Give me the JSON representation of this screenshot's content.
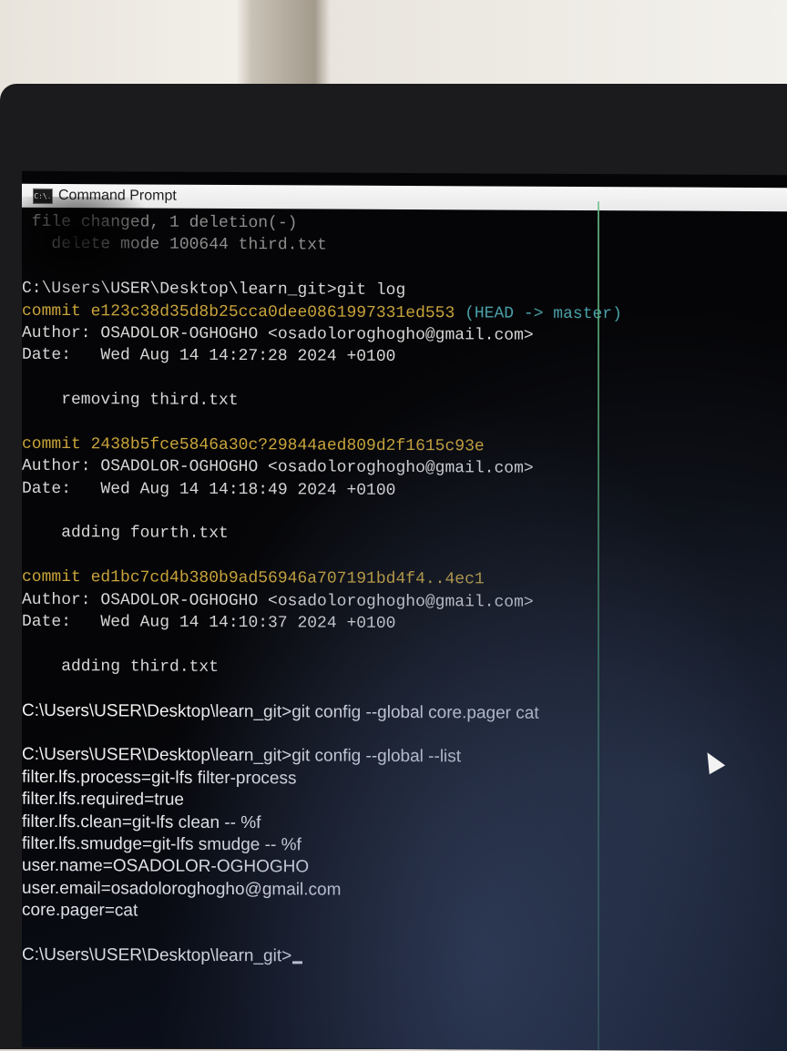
{
  "window": {
    "title": "Command Prompt",
    "icon": "cmd-icon",
    "icon_text": "C:\\."
  },
  "console": {
    "lines": [
      {
        "text": " file changed, 1 deletion(-)",
        "kind": "dim"
      },
      {
        "text": "   delete mode 100644 third.txt",
        "kind": "dim"
      },
      {
        "text": "",
        "kind": "normal"
      },
      {
        "text": "C:\\Users\\USER\\Desktop\\learn_git>git log",
        "kind": "normal"
      },
      {
        "text": "commit e123c38d35d8b25cca0dee0861997331ed553",
        "kind": "commit",
        "ref": " (HEAD -> master)"
      },
      {
        "text": "Author: OSADOLOR-OGHOGHO <osadoloroghogho@gmail.com>",
        "kind": "normal"
      },
      {
        "text": "Date:   Wed Aug 14 14:27:28 2024 +0100",
        "kind": "normal"
      },
      {
        "text": "",
        "kind": "normal"
      },
      {
        "text": "    removing third.txt",
        "kind": "normal"
      },
      {
        "text": "",
        "kind": "normal"
      },
      {
        "text": "commit 2438b5fce5846a30c?29844aed809d2f1615c93e",
        "kind": "commit"
      },
      {
        "text": "Author: OSADOLOR-OGHOGHO <osadoloroghogho@gmail.com>",
        "kind": "normal"
      },
      {
        "text": "Date:   Wed Aug 14 14:18:49 2024 +0100",
        "kind": "normal"
      },
      {
        "text": "",
        "kind": "normal"
      },
      {
        "text": "    adding fourth.txt",
        "kind": "normal"
      },
      {
        "text": "",
        "kind": "normal"
      },
      {
        "text": "commit ed1bc7cd4b380b9ad56946a707191bd4f4..4ec1",
        "kind": "commit"
      },
      {
        "text": "Author: OSADOLOR-OGHOGHO <osadoloroghogho@gmail.com>",
        "kind": "normal"
      },
      {
        "text": "Date:   Wed Aug 14 14:10:37 2024 +0100",
        "kind": "normal"
      },
      {
        "text": "",
        "kind": "normal"
      },
      {
        "text": "    adding third.txt",
        "kind": "normal"
      },
      {
        "text": "",
        "kind": "normal"
      },
      {
        "text": "C:\\Users\\USER\\Desktop\\learn_git>git config --global core.pager cat",
        "kind": "bright"
      },
      {
        "text": "",
        "kind": "normal"
      },
      {
        "text": "C:\\Users\\USER\\Desktop\\learn_git>git config --global --list",
        "kind": "bright"
      },
      {
        "text": "filter.lfs.process=git-lfs filter-process",
        "kind": "bright"
      },
      {
        "text": "filter.lfs.required=true",
        "kind": "bright"
      },
      {
        "text": "filter.lfs.clean=git-lfs clean -- %f",
        "kind": "bright"
      },
      {
        "text": "filter.lfs.smudge=git-lfs smudge -- %f",
        "kind": "bright"
      },
      {
        "text": "user.name=OSADOLOR-OGHOGHO",
        "kind": "bright"
      },
      {
        "text": "user.email=osadoloroghogho@gmail.com",
        "kind": "bright"
      },
      {
        "text": "core.pager=cat",
        "kind": "bright"
      },
      {
        "text": "",
        "kind": "normal"
      },
      {
        "text": "C:\\Users\\USER\\Desktop\\learn_git>",
        "kind": "bright",
        "cursor": true
      }
    ]
  },
  "colors": {
    "console_bg": "#050507",
    "commit": "#c9a43a",
    "head_ref": "#4aa0a8",
    "text": "#d6d6d6"
  }
}
